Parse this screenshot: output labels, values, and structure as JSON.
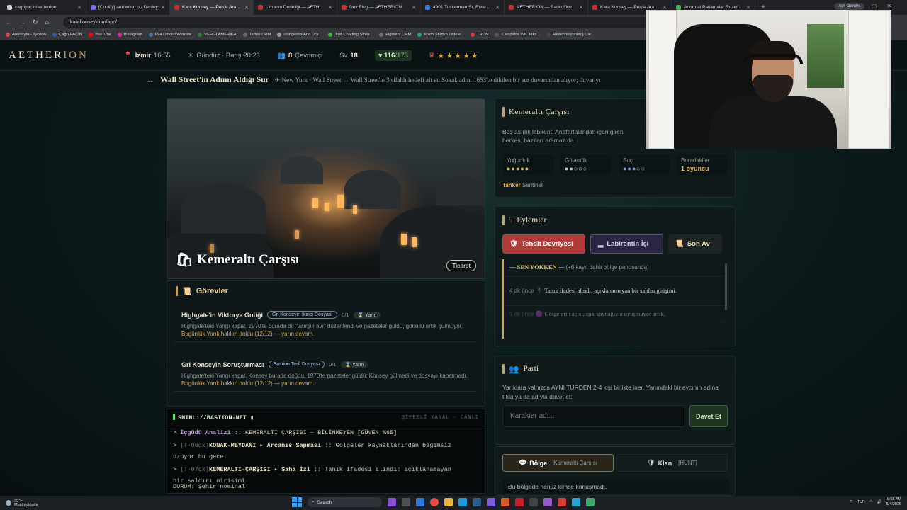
{
  "browser": {
    "tabs": [
      {
        "title": "cagripacin/aetherion",
        "color": "#d0d0d0",
        "active": false
      },
      {
        "title": "[Coolify] aetherion.o - Deploy",
        "color": "#7b6cf0",
        "active": false
      },
      {
        "title": "Kara Konsey — Perde Aralanıyo",
        "color": "#c03030",
        "active": true
      },
      {
        "title": "Limanın Derinliği — AETHERION",
        "color": "#c03030",
        "active": false
      },
      {
        "title": "Dev Blog — AETHERION",
        "color": "#c03030",
        "active": false
      },
      {
        "title": "4901 Tuckerman St, Riverdale",
        "color": "#3e7be0",
        "active": false
      },
      {
        "title": "AETHERION — Backoffice",
        "color": "#c03030",
        "active": false
      },
      {
        "title": "Kara Konsey — Perde Aralanıyo",
        "color": "#c03030",
        "active": false
      },
      {
        "title": "Anormal Patlamalar Rozetleri Sil",
        "color": "#4caf50",
        "active": false
      }
    ],
    "profile": "Aşk Gemini",
    "url": "karakonsey.com/app/",
    "bookmarks": [
      {
        "label": "Anasayfa - Tycoon",
        "color": "#e0443e"
      },
      {
        "label": "Çağrı PAÇİN",
        "color": "#3b5998"
      },
      {
        "label": "YouTube",
        "color": "#ff0000"
      },
      {
        "label": "Instagram",
        "color": "#d6249f"
      },
      {
        "label": "I-94 Official Website",
        "color": "#4a6fa5"
      },
      {
        "label": "VERGİ AMERİKA",
        "color": "#2e7d32"
      },
      {
        "label": "Tattoo CRM",
        "color": "#666666"
      },
      {
        "label": "Dungeons And Dra...",
        "color": "#999999"
      },
      {
        "label": "Just Chatting Strea...",
        "color": "#3cb043"
      },
      {
        "label": "Pigment CRM",
        "color": "#6f6f6f"
      },
      {
        "label": "Krem Stüdyo Listele...",
        "color": "#2a9d8f"
      },
      {
        "label": "TRON",
        "color": "#e53935"
      },
      {
        "label": "Cleopatra INK Ileks...",
        "color": "#555555"
      },
      {
        "label": "Rezervasyonlar | Cle...",
        "color": "#444444"
      }
    ]
  },
  "header": {
    "logo_a": "AETHER",
    "logo_b": "ION",
    "city": "İzmir",
    "time": "16:55",
    "daylight": "Gündüz · Batış 20:23",
    "online_count": "8",
    "online_label": "Çevrimiçi",
    "level_label": "Sv",
    "level": "18",
    "hp": "116",
    "hp_max": "/173",
    "stars": "★★★★★"
  },
  "ticker": {
    "title": "Wall Street'in Adımı Aldığı Sur",
    "desc": "New York · Wall Street → Wall Street'te 3 silahlı hedefi alt et. Sokak adını 1653'te dikilen bir sur duvarından alıyor; duvar yı"
  },
  "hero": {
    "title": "Kemeraltı Çarşısı",
    "tag": "Ticaret"
  },
  "quests": {
    "heading": "Görevler",
    "items": [
      {
        "name": "Highgate'in Viktorya Gotiği",
        "tag": "Gri Konseyin İkinci Dosyası",
        "count": "0/1",
        "time": "Yarın",
        "desc": "Highgate'teki Yangı kapat. 1970'te burada bir \"vampir avı\" düzenlendi ve gazeteler güldü; gönüllü artık gülmüyor.",
        "warn": "Bugünlük Yarık hakkın doldu (12/12) — yarın devam."
      },
      {
        "name": "Gri Konseyin Soruşturması",
        "tag": "Bastion Terfi Dosyası",
        "count": "0/1",
        "time": "Yarın",
        "desc": "Highgate'teki Yangı kapat. Konsey burada doğdu. 1970'te gazeteler güldü; Konsey gülmedi ve dosyayı kapatmadı.",
        "warn": "Bugünlük Yarık hakkın doldu (12/12) — yarın devam."
      }
    ]
  },
  "terminal": {
    "title": "SNTNL://BASTION-NET",
    "status": "ŞİFRELİ KANAL · CANLI",
    "line1_tag": "İçgüdü Analizi",
    "line1_text": ":: KEMERALTI ÇARŞISI — BİLİNMEYEN [GÜVEN %65]",
    "line2_time": "[T-06dk]",
    "line2_place": "KONAK-MEYDANI",
    "line2_who": "Arcanis Sapması",
    "line2_text": ":: Gölgeler kaynaklarından bağımsız",
    "line2_text2": "uzuyor bu gece.",
    "line3_time": "[T-07dk]",
    "line3_place": "KEMERALTI-ÇARŞISI",
    "line3_who": "Saha İzi",
    "line3_text": ":: Tanık ifadesi alındı: açıklanamayan",
    "line3_text2": "bir saldırı girişimi.",
    "status_line": "DURUM: Şehir nominal"
  },
  "location": {
    "title": "Kemeraltı Çarşısı",
    "desc": "Beş asırlık labirent. Anafartalar'dan içeri giren herkes, bazıları aramaz da.",
    "stats": [
      {
        "label": "Yoğunluk",
        "value": "●●●●●"
      },
      {
        "label": "Güvenlik",
        "value": "●●○○○"
      },
      {
        "label": "Suç",
        "value": "●●●○○"
      },
      {
        "label": "Buradakiler",
        "value": "1 oyuncu"
      }
    ],
    "role": "Tanker",
    "role_sub": "Sentinel"
  },
  "actions": {
    "heading": "Eylemler",
    "buttons": [
      "Tehdit Devriyesi",
      "Labirentin İçi",
      "Son Av"
    ],
    "feed_head": "— SEN YOKKEN —",
    "feed_more": "(+6 kayıt daha bölge panosunda)",
    "feed": [
      {
        "ago": "4 dk önce",
        "text": "Tanık ifadesi alındı: açıklanamayan bir saldırı girişimi."
      },
      {
        "ago": "5 dk önce",
        "text": "Gölgelerin açısı, ışık kaynağıyla uyuşmuyor artık."
      }
    ]
  },
  "party": {
    "heading": "Parti",
    "desc": "Yarıklara yalnızca AYNI TÜRDEN 2-4 kişi birlikte iner. Yanındaki bir avcının adına tıkla ya da adıyla davet et:",
    "placeholder": "Karakter adı...",
    "button": "Davet Et"
  },
  "chat": {
    "tab1": "Bölge",
    "tab1_sub": "· Kemeraltı Çarşısı",
    "tab2": "Klan",
    "tab2_sub": "· [HUNT]",
    "empty": "Bu bölgede henüz kimse konuşmadı."
  },
  "taskbar": {
    "temp": "35°F",
    "weather": "Mostly cloudy",
    "search": "Search",
    "lang": "TUR",
    "time": "9:55 AM",
    "date": "5/4/2026"
  }
}
